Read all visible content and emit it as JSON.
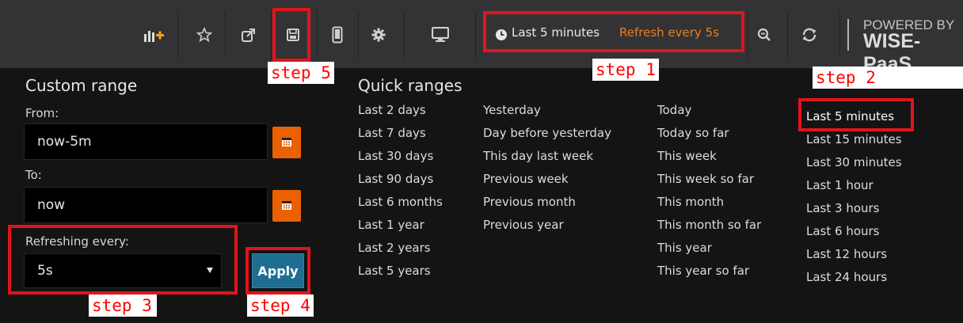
{
  "toolbar": {
    "icons": [
      "add-panel-icon",
      "star-icon",
      "share-icon",
      "save-icon",
      "mobile-icon",
      "gear-icon",
      "monitor-icon",
      "zoom-out-icon",
      "refresh-icon"
    ],
    "time_range": "Last 5 minutes",
    "refresh_text": "Refresh every 5s",
    "powered_by": "POWERED BY",
    "brand": "WISE-PaaS"
  },
  "custom_range": {
    "title": "Custom range",
    "from_label": "From:",
    "from_value": "now-5m",
    "to_label": "To:",
    "to_value": "now",
    "refresh_label": "Refreshing every:",
    "refresh_value": "5s",
    "apply_label": "Apply"
  },
  "quick_ranges": {
    "title": "Quick ranges",
    "col1": [
      "Last 2 days",
      "Last 7 days",
      "Last 30 days",
      "Last 90 days",
      "Last 6 months",
      "Last 1 year",
      "Last 2 years",
      "Last 5 years"
    ],
    "col2": [
      "Yesterday",
      "Day before yesterday",
      "This day last week",
      "Previous week",
      "Previous month",
      "Previous year"
    ],
    "col3": [
      "Today",
      "Today so far",
      "This week",
      "This week so far",
      "This month",
      "This month so far",
      "This year",
      "This year so far"
    ],
    "col4": [
      "Last 5 minutes",
      "Last 15 minutes",
      "Last 30 minutes",
      "Last 1 hour",
      "Last 3 hours",
      "Last 6 hours",
      "Last 12 hours",
      "Last 24 hours"
    ]
  },
  "steps": {
    "step1": "step 1",
    "step2": "step 2",
    "step3": "step 3",
    "step4": "step 4",
    "step5": "step 5"
  },
  "colors": {
    "highlight": "#e1141c",
    "accent_orange": "#eb6100",
    "apply_blue": "#1e6e92"
  }
}
